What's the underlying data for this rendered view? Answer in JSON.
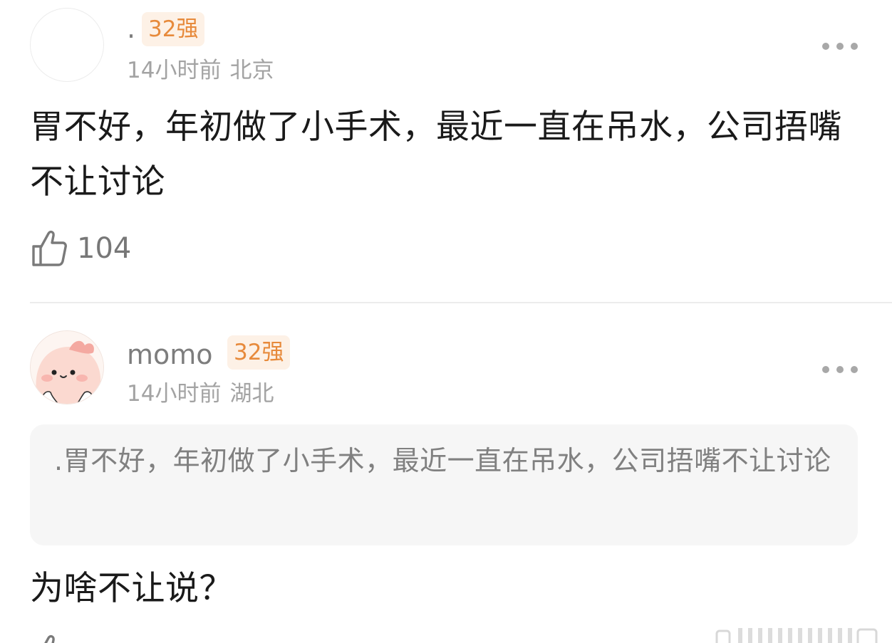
{
  "comments": [
    {
      "username": ".",
      "badge": "32强",
      "time": "14小时前",
      "location": "北京",
      "text": "胃不好，年初做了小手术，最近一直在吊水，公司捂嘴不让讨论",
      "likes": "104",
      "more_icon": "more-dots-icon",
      "like_icon": "thumbs-up-icon"
    },
    {
      "username": "momo",
      "badge": "32强",
      "time": "14小时前",
      "location": "湖北",
      "quoted_text": ".胃不好，年初做了小手术，最近一直在吊水，公司捂嘴不让讨论",
      "text": "为啥不让说？",
      "more_icon": "more-dots-icon"
    }
  ],
  "colors": {
    "badge_text": "#e78a3b",
    "badge_bg": "#fdf1e6",
    "meta_text": "#a3a3a3",
    "body_text": "#1a1a1a",
    "quote_bg": "#f6f6f6"
  }
}
